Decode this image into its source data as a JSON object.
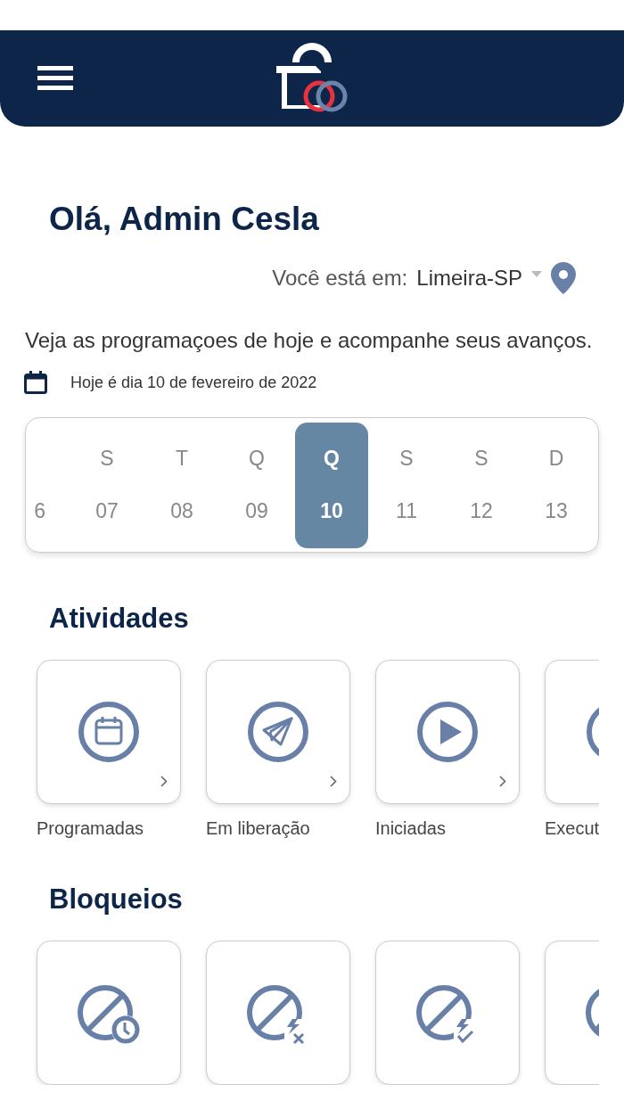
{
  "greeting": "Olá, Admin Cesla",
  "location": {
    "label": "Você está em:",
    "value": "Limeira-SP"
  },
  "intro": "Veja as programaçoes de hoje e acompanhe seus avanços.",
  "today": "Hoje é dia 10 de fevereiro de 2022",
  "calendar": [
    {
      "date": "6",
      "selected": false
    },
    {
      "weekday": "S",
      "date": "07",
      "selected": false
    },
    {
      "weekday": "T",
      "date": "08",
      "selected": false
    },
    {
      "weekday": "Q",
      "date": "09",
      "selected": false
    },
    {
      "weekday": "Q",
      "date": "10",
      "selected": true
    },
    {
      "weekday": "S",
      "date": "11",
      "selected": false
    },
    {
      "weekday": "S",
      "date": "12",
      "selected": false
    },
    {
      "weekday": "D",
      "date": "13",
      "selected": false
    }
  ],
  "sections": [
    {
      "title": "Atividades",
      "cards": [
        {
          "kind": "calendar",
          "label": "Programadas"
        },
        {
          "kind": "send",
          "label": "Em liberação"
        },
        {
          "kind": "play",
          "label": "Iniciadas"
        },
        {
          "kind": "ring",
          "label": "Execut"
        }
      ]
    },
    {
      "title": "Bloqueios",
      "cards": [
        {
          "kind": "block-clock"
        },
        {
          "kind": "block-bolt-x"
        },
        {
          "kind": "block-bolt-check"
        },
        {
          "kind": "block"
        }
      ]
    }
  ]
}
